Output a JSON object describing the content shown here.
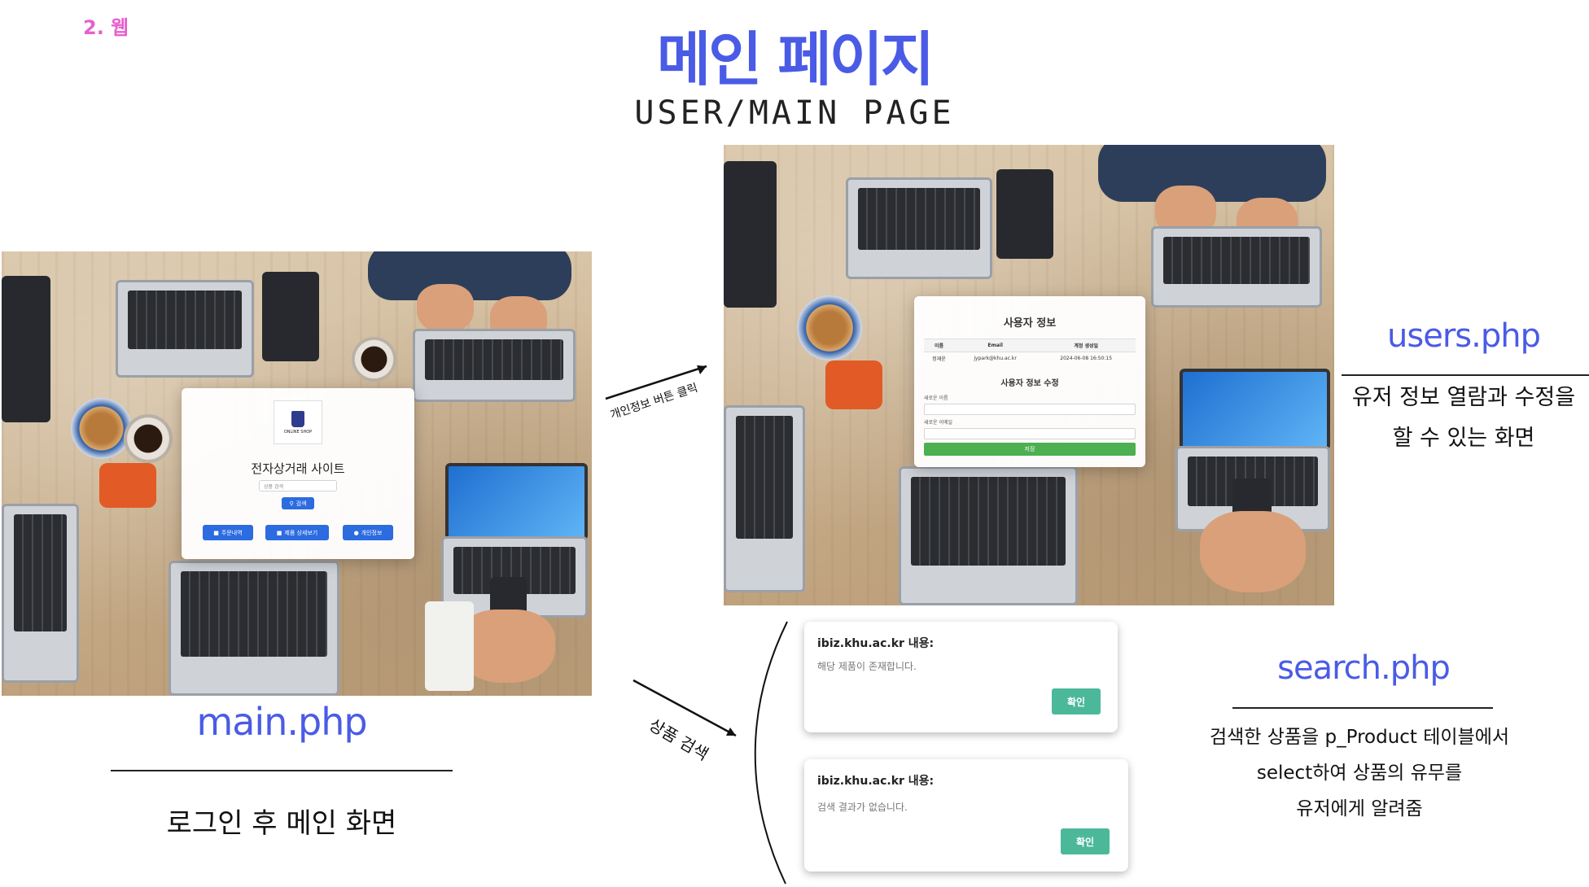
{
  "section_tag": "2. 웹",
  "title": "메인 페이지",
  "subtitle": "USER/MAIN PAGE",
  "main_panel": {
    "logo_text": "ONLINE SHOP",
    "site_title": "전자상거래 사이트",
    "search_placeholder": "상품 검색",
    "search_button": "검색",
    "buttons": [
      "주문내역",
      "제품 상세보기",
      "개인정보"
    ],
    "file_label": "main.php",
    "description": "로그인 후 메인 화면"
  },
  "arrows": {
    "to_users": "개인정보 버튼 클릭",
    "to_search": "상품 검색"
  },
  "users_panel": {
    "card_title": "사용자 정보",
    "table_headers": [
      "이름",
      "Email",
      "계정 생성일"
    ],
    "table_row": [
      "정재윤",
      "jypark@khu.ac.kr",
      "2024-06-08 16:50:15"
    ],
    "edit_title": "사용자 정보 수정",
    "new_name_label": "새로운 이름",
    "new_email_label": "새로운 이메일",
    "save_button": "저장",
    "file_label": "users.php",
    "description_lines": [
      "유저 정보 열람과 수정을",
      "할 수 있는 화면"
    ]
  },
  "search_panel": {
    "alerts": [
      {
        "title": "ibiz.khu.ac.kr 내용:",
        "message": "해당 제품이 존재합니다.",
        "button": "확인"
      },
      {
        "title": "ibiz.khu.ac.kr 내용:",
        "message": "검색 결과가 없습니다.",
        "button": "확인"
      }
    ],
    "file_label": "search.php",
    "description_lines": [
      "검색한 상품을 p_Product 테이블에서",
      "select하여 상품의 유무를",
      "유저에게 알려줌"
    ]
  },
  "colors": {
    "accent_blue": "#4a5be6",
    "tag_pink": "#e85fcf",
    "button_blue": "#2c6be0",
    "save_green": "#4caf50",
    "confirm_teal": "#4cb89a"
  }
}
